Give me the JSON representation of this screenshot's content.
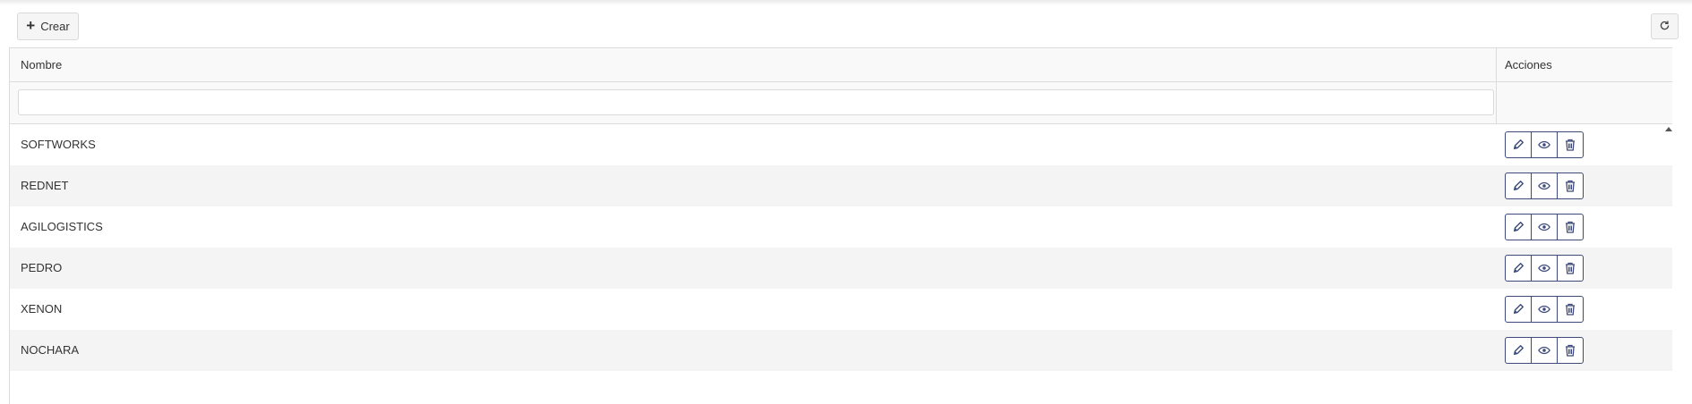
{
  "toolbar": {
    "create_label": "Crear",
    "create_icon": "plus-icon",
    "refresh_icon": "refresh-icon"
  },
  "table": {
    "columns": [
      "Nombre",
      "Acciones"
    ],
    "filter": {
      "value": "",
      "placeholder": ""
    },
    "rows": [
      {
        "name": "SOFTWORKS"
      },
      {
        "name": "REDNET"
      },
      {
        "name": "AGILOGISTICS"
      },
      {
        "name": "PEDRO"
      },
      {
        "name": "XENON"
      },
      {
        "name": "NOCHARA"
      }
    ],
    "row_actions": [
      "edit-icon",
      "view-icon",
      "delete-icon"
    ]
  },
  "colors": {
    "action_accent": "#3d4a7a",
    "row_alt": "#f4f4f4",
    "header_bg": "#f9f9f9"
  }
}
